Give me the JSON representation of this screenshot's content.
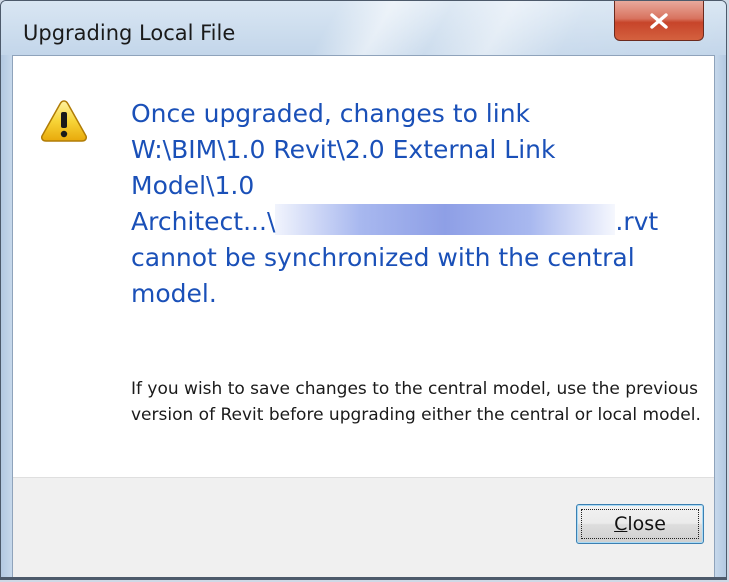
{
  "window": {
    "title": "Upgrading Local File"
  },
  "titlebar": {
    "close_icon": "close-x-icon"
  },
  "dialog": {
    "icon": "warning-icon",
    "main_instruction": {
      "line1": "Once upgraded, changes to link",
      "line2": "W:\\BIM\\1.0 Revit\\2.0 External Link",
      "line3": "Model\\1.0",
      "line4_prefix": "Architect...\\",
      "line4_suffix": ".rvt",
      "line5": "cannot be synchronized with the central",
      "line6": "model."
    },
    "content": "If you wish to save changes to the central model, use the previous version of Revit before upgrading either the central or local model."
  },
  "footer": {
    "close_button": {
      "accel": "C",
      "rest": "lose"
    }
  },
  "colors": {
    "instruction_text": "#1a50b8",
    "title_close_red": "#c7442a"
  }
}
